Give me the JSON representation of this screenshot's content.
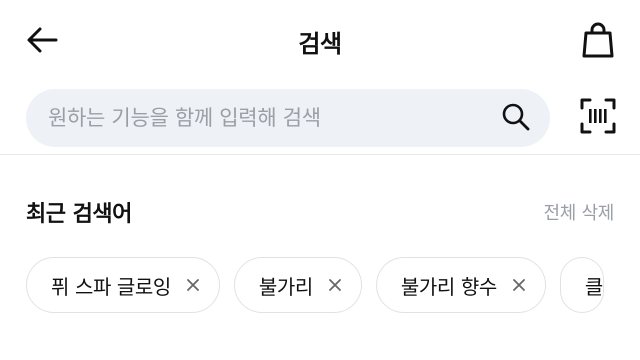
{
  "header": {
    "title": "검색",
    "back_icon": "arrow-left-icon",
    "bag_icon": "shopping-bag-icon"
  },
  "search": {
    "placeholder": "원하는 기능을 함께 입력해 검색",
    "value": "",
    "search_icon": "search-icon",
    "barcode_icon": "barcode-scan-icon"
  },
  "recent": {
    "title": "최근 검색어",
    "clear_all_label": "전체 삭제",
    "items": [
      {
        "label": "퓌 스파 글로잉"
      },
      {
        "label": "불가리"
      },
      {
        "label": "불가리 향수"
      },
      {
        "label": "클"
      }
    ]
  },
  "colors": {
    "search_bg": "#eef1f6",
    "muted_text": "#9a9ea6",
    "chip_border": "#dfe2e7",
    "divider": "#e6e8ec"
  }
}
